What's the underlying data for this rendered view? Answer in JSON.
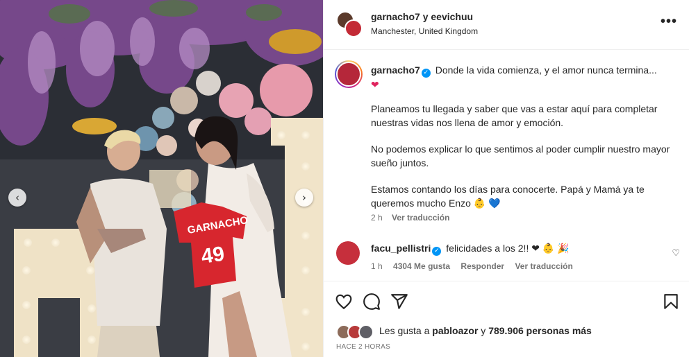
{
  "post_header": {
    "usernames": "garnacho7",
    "connector": "y",
    "second_user": "eevichuu",
    "location": "Manchester, United Kingdom",
    "more_icon": "more-options-icon",
    "more_label": "•••"
  },
  "caption": {
    "username": "garnacho7",
    "verified_mark": "✓",
    "line1": "Donde la vida comienza, y el amor nunca termina...",
    "line1_emoji": "❤",
    "p2": "Planeamos tu llegada y saber que vas a estar aquí para completar nuestras vidas nos llena de amor y emoción.",
    "p3": "No podemos explicar lo que sentimos al poder cumplir nuestro mayor sueño juntos.",
    "p4": "Estamos contando los días para conocerte. Papá y Mamá ya te queremos mucho Enzo",
    "p4_emoji_baby": "👶",
    "p4_emoji_heart": "💙",
    "time": "2 h",
    "translate": "Ver traducción"
  },
  "comment": {
    "username": "facu_pellistri",
    "verified_mark": "✓",
    "text": "felicidades a los 2!!",
    "emojis": "❤ 👶 🎉",
    "time": "1 h",
    "likes": "4304 Me gusta",
    "reply": "Responder",
    "translate": "Ver traducción",
    "heart_icon": "♡"
  },
  "actions": {
    "like_icon": "heart-outline-icon",
    "comment_icon": "comment-icon",
    "share_icon": "share-icon",
    "save_icon": "bookmark-icon"
  },
  "likes": {
    "prefix": "Les gusta a",
    "user": "pabloazor",
    "connector": "y",
    "count": "789.906 personas más"
  },
  "posted": "HACE 2 HORAS",
  "photo": {
    "jersey_name": "GARNACHO",
    "jersey_number": "49",
    "prev_arrow": "‹",
    "next_arrow": "›"
  },
  "colors": {
    "verified": "#0095f6",
    "jersey": "#d7262e",
    "secondary_text": "#737373"
  }
}
